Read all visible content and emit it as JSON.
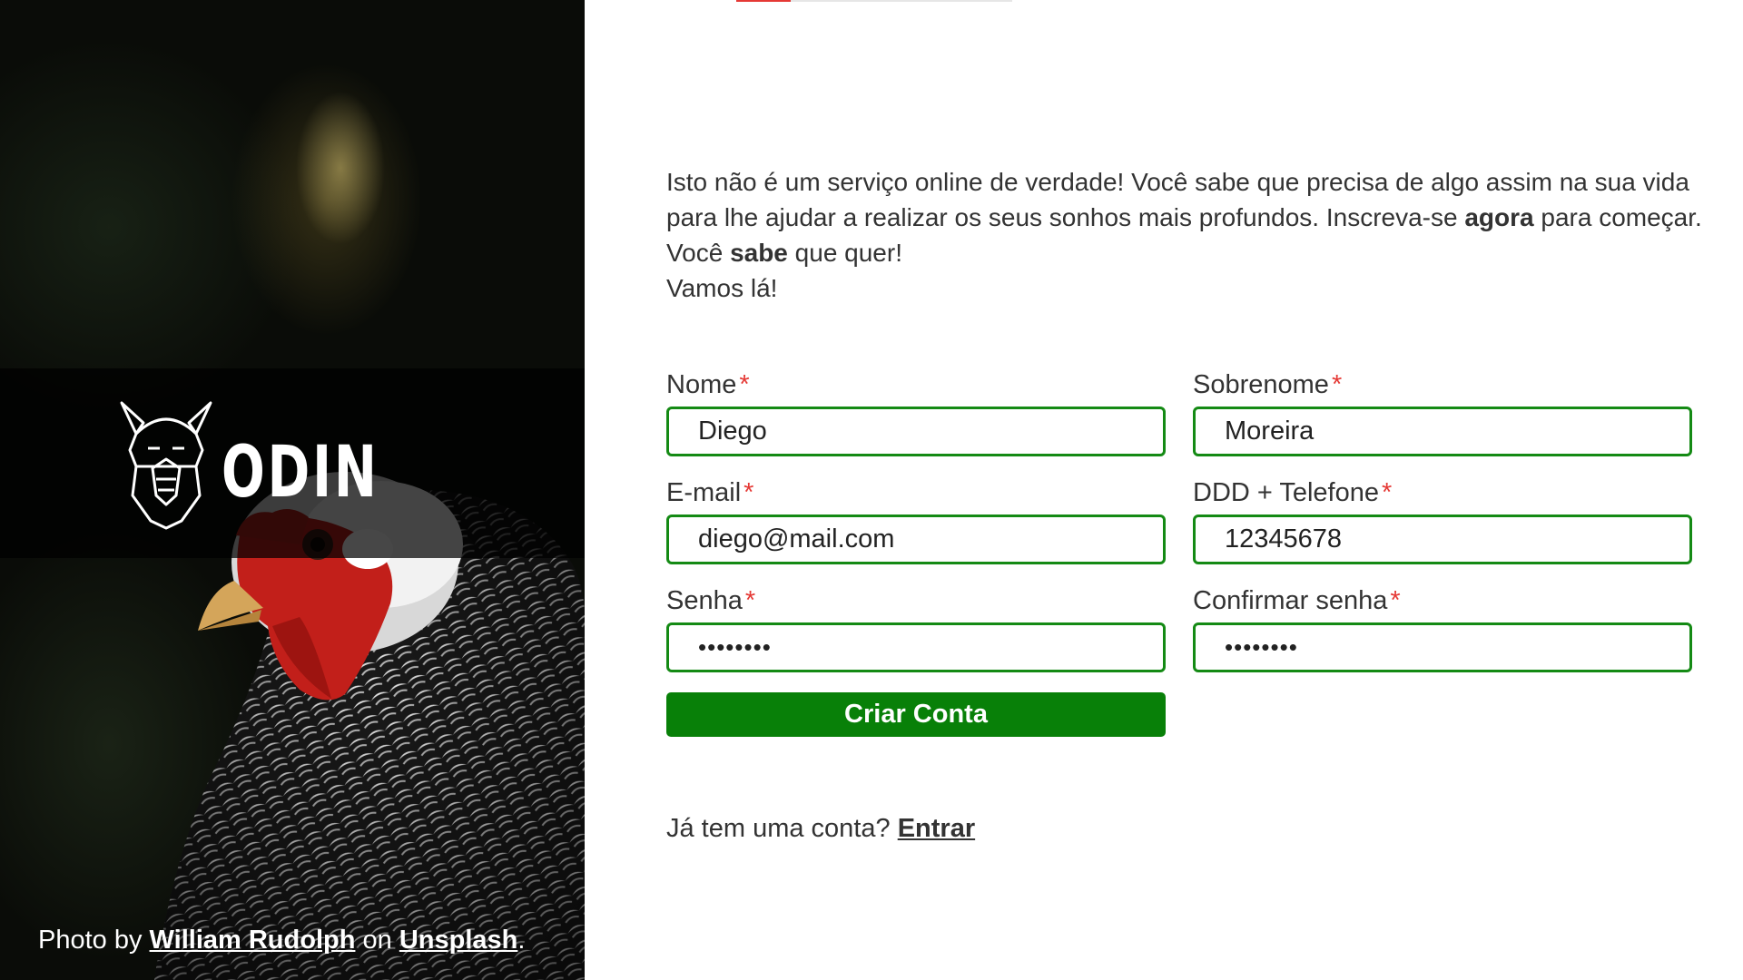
{
  "sidebar": {
    "logo_text": "ODIN",
    "credit": {
      "prefix": "Photo by",
      "author": "William Rudolph",
      "middle": "on",
      "site": "Unsplash",
      "suffix": "."
    }
  },
  "intro": {
    "part1": "Isto não é um serviço online de verdade! Você sabe que precisa de algo assim na sua vida para lhe ajudar a realizar os seus sonhos mais profundos. Inscreva-se ",
    "bold1": "agora",
    "part2": " para começar.",
    "line2_a": "Você ",
    "line2_bold": "sabe",
    "line2_b": " que quer!",
    "line3": "Vamos lá!"
  },
  "form": {
    "required_marker": "*",
    "first_name": {
      "label": "Nome",
      "value": "Diego"
    },
    "last_name": {
      "label": "Sobrenome",
      "value": "Moreira"
    },
    "email": {
      "label": "E-mail",
      "value": "diego@mail.com"
    },
    "phone": {
      "label": "DDD + Telefone",
      "value": "12345678"
    },
    "password": {
      "label": "Senha",
      "value": "••••••••"
    },
    "confirm_password": {
      "label": "Confirmar senha",
      "value": "••••••••"
    },
    "submit_label": "Criar Conta"
  },
  "login": {
    "prompt": "Já tem uma conta?",
    "link": "Entrar"
  },
  "colors": {
    "accent_green": "#088008",
    "input_border": "#148a14",
    "required": "#e53935"
  }
}
